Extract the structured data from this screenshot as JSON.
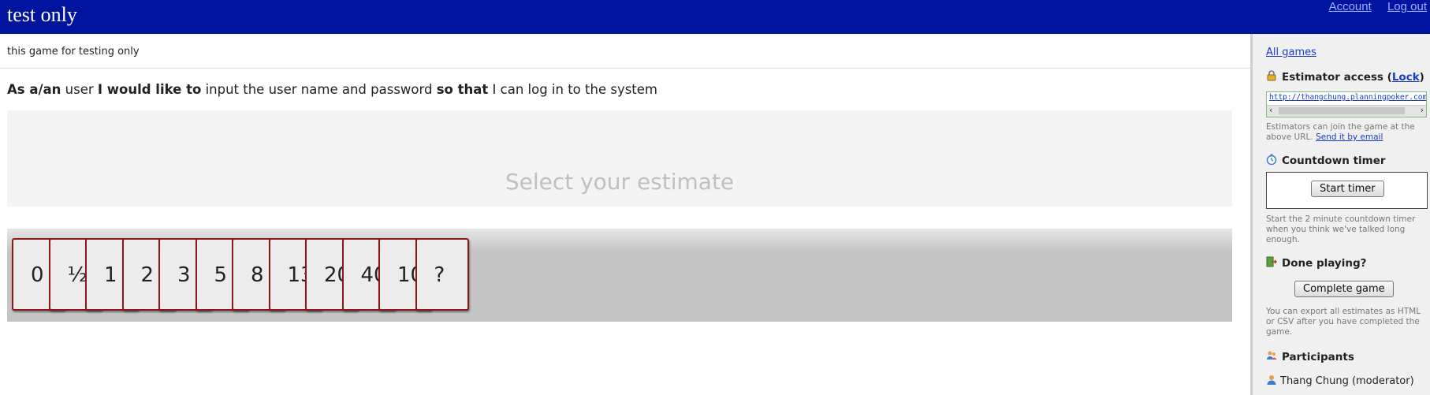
{
  "header": {
    "title": "test only",
    "account_label": "Account",
    "logout_label": "Log out"
  },
  "game": {
    "description": "this game for testing only",
    "story": {
      "as_label": "As a/an",
      "role": "user",
      "want_label": "I would like to",
      "goal": "input the user name and password",
      "so_label": "so that",
      "benefit": "I can log in to the system"
    },
    "estimate_prompt": "Select your estimate"
  },
  "cards": [
    "0",
    "½",
    "1",
    "2",
    "3",
    "5",
    "8",
    "13",
    "20",
    "40",
    "100",
    "?"
  ],
  "sidebar": {
    "all_games_label": "All games",
    "estimator_access": {
      "heading_prefix": "Estimator access (",
      "lock_label": "Lock",
      "heading_suffix": ")",
      "url": "http://thangchung.planningpoker.com/xx",
      "note": "Estimators can join the game at the above URL.",
      "send_email_label": "Send it by email"
    },
    "countdown": {
      "heading": "Countdown timer",
      "start_label": "Start timer",
      "note": "Start the 2 minute countdown timer when you think we've talked long enough."
    },
    "done": {
      "heading": "Done playing?",
      "complete_label": "Complete game",
      "note": "You can export all estimates as HTML or CSV after you have completed the game."
    },
    "participants": {
      "heading": "Participants",
      "items": [
        "Thang Chung (moderator)"
      ]
    }
  },
  "colors": {
    "header_bg": "#0014a0",
    "card_border": "#8a1818",
    "link": "#1a3acc"
  }
}
